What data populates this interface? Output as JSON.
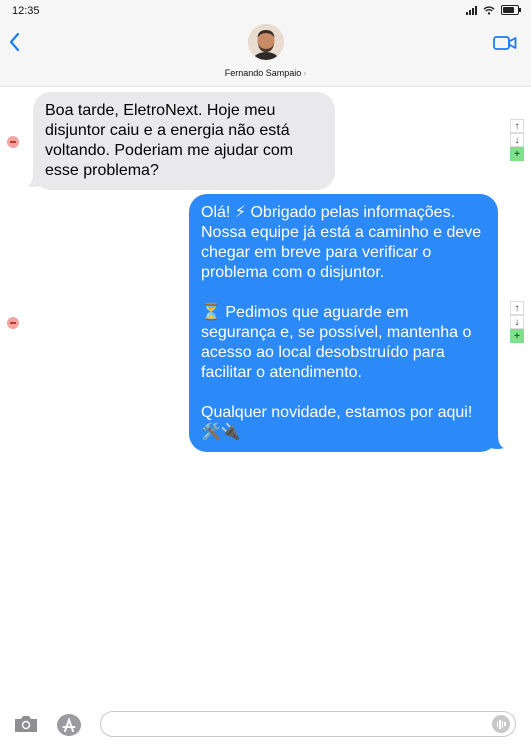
{
  "status_bar": {
    "time": "12:35"
  },
  "header": {
    "contact_name": "Fernando Sampaio",
    "chevron": "›",
    "icons": {
      "back": "chevron-left-icon",
      "video": "video-camera-icon"
    }
  },
  "messages": [
    {
      "direction": "incoming",
      "paragraphs": [
        "Boa tarde, EletroNext. Hoje meu disjuntor caiu e a energia não está voltando. Poderiam me ajudar com esse problema?"
      ]
    },
    {
      "direction": "outgoing",
      "paragraphs": [
        "Olá! ⚡ Obrigado pelas informações. Nossa equipe já está a caminho e deve chegar em breve para verificar o problema com o disjuntor.",
        "⏳ Pedimos que aguarde em segurança e, se possível, mantenha o acesso ao local desobstruído para facilitar o atendimento.",
        "Qualquer novidade, estamos por aqui! 🛠️🔌"
      ]
    }
  ],
  "controls": {
    "up": "↑",
    "down": "↓",
    "add": "+"
  },
  "composer": {
    "placeholder": ""
  },
  "colors": {
    "outgoing_bubble": "#2b8af7",
    "incoming_bubble": "#e9e9eb",
    "accent": "#1a7cf5",
    "remove": "#f1a4a2",
    "add": "#7fe08c"
  }
}
